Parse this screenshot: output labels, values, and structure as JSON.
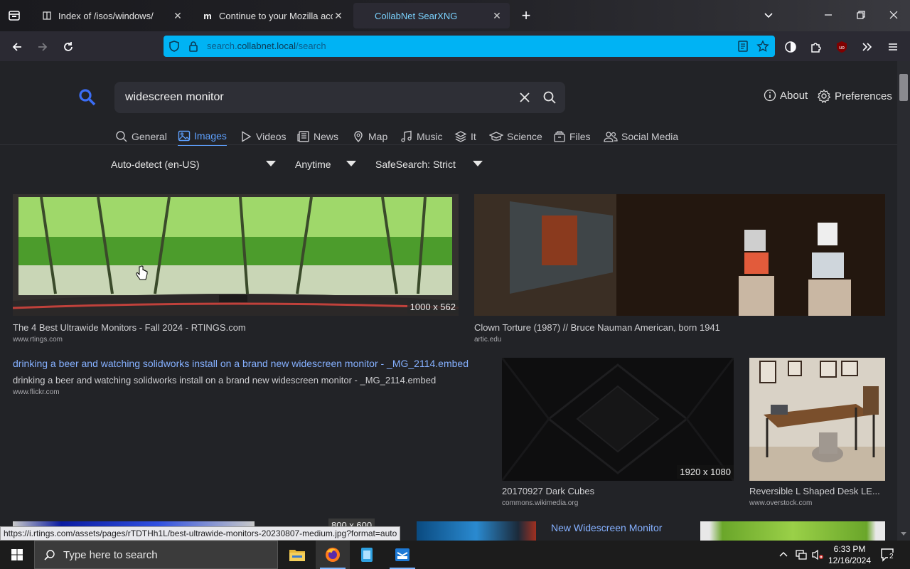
{
  "browser": {
    "tabs": [
      {
        "title": "Index of /isos/windows/",
        "icon": "book-icon",
        "active": false
      },
      {
        "title": "Continue to your Mozilla accou",
        "icon": "mozilla-m-icon",
        "active": false
      },
      {
        "title": "CollabNet SearXNG",
        "icon": "",
        "active": true
      }
    ],
    "new_tab_symbol": "+",
    "url": {
      "prefix": "search.",
      "host": "collabnet.local",
      "path": "/search"
    },
    "accent_color": "#00b3f4"
  },
  "searx": {
    "query": "widescreen monitor",
    "about_label": "About",
    "preferences_label": "Preferences",
    "categories": [
      {
        "label": "General",
        "icon": "search-icon",
        "active": false
      },
      {
        "label": "Images",
        "icon": "image-icon",
        "active": true
      },
      {
        "label": "Videos",
        "icon": "play-icon",
        "active": false
      },
      {
        "label": "News",
        "icon": "newspaper-icon",
        "active": false
      },
      {
        "label": "Map",
        "icon": "map-pin-icon",
        "active": false
      },
      {
        "label": "Music",
        "icon": "music-note-icon",
        "active": false
      },
      {
        "label": "It",
        "icon": "layers-icon",
        "active": false
      },
      {
        "label": "Science",
        "icon": "graduation-cap-icon",
        "active": false
      },
      {
        "label": "Files",
        "icon": "files-icon",
        "active": false
      },
      {
        "label": "Social Media",
        "icon": "people-icon",
        "active": false
      }
    ],
    "filters": {
      "language": "Auto-detect (en-US)",
      "time": "Anytime",
      "safesearch": "SafeSearch: Strict"
    },
    "results": [
      {
        "title": "The 4 Best Ultrawide Monitors - Fall 2024 - RTINGS.com",
        "url": "www.rtings.com",
        "resolution": "1000 x 562"
      },
      {
        "title": "Clown Torture (1987) // Bruce Nauman American, born 1941",
        "url": "artic.edu",
        "resolution": ""
      },
      {
        "link_title": "drinking a beer and watching solidworks install on a brand new widescreen monitor - _MG_2114.embed",
        "title": "drinking a beer and watching solidworks install on a brand new widescreen monitor - _MG_2114.embed",
        "url": "www.flickr.com"
      },
      {
        "title": "20170927 Dark Cubes",
        "url": "commons.wikimedia.org",
        "resolution": "1920 x 1080"
      },
      {
        "title": "Reversible L Shaped Desk LE...",
        "url": "www.overstock.com",
        "resolution": ""
      },
      {
        "link_title": "New Widescreen Monitor",
        "resolution": "800 x 600"
      }
    ],
    "hover_status_url": "https://i.rtings.com/assets/pages/rTDTHh1L/best-ultrawide-monitors-20230807-medium.jpg?format=auto"
  },
  "taskbar": {
    "search_placeholder": "Type here to search",
    "time": "6:33 PM",
    "date": "12/16/2024",
    "notification_count": "2"
  }
}
